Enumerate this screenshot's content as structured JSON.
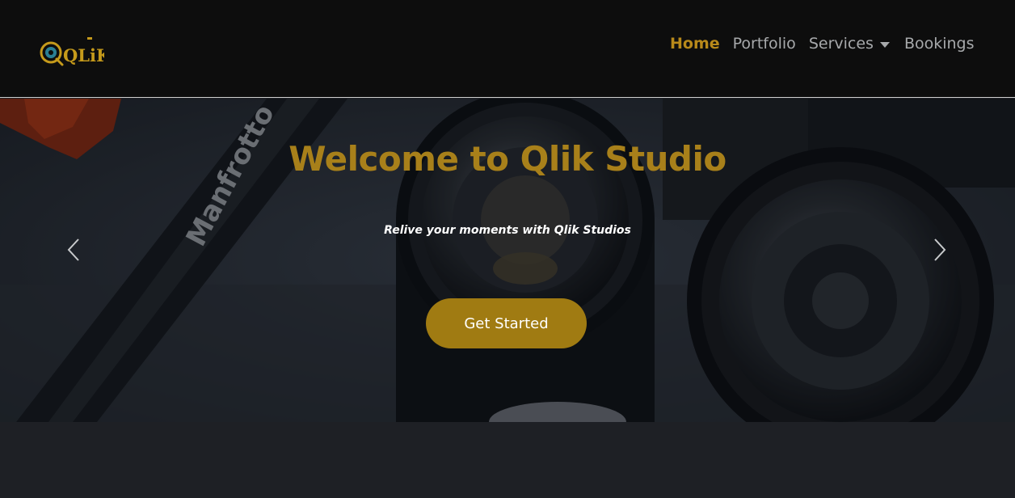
{
  "brand": {
    "logo_text": "QLiK"
  },
  "nav": {
    "home": "Home",
    "portfolio": "Portfolio",
    "services": "Services",
    "bookings": "Bookings"
  },
  "hero": {
    "title": "Welcome to Qlik Studio",
    "subtitle": "Relive your moments with Qlik Studios",
    "cta_label": "Get Started",
    "photo_subject": "camera lenses and Manfrotto tripod",
    "photo_text": "Manfrotto"
  },
  "carousel": {
    "prev_icon": "chevron-left-icon",
    "next_icon": "chevron-right-icon"
  },
  "colors": {
    "accent": "#b8891a",
    "header_bg": "#0d0d0d",
    "button_bg": "#a07b12",
    "page_bg": "#1e2025"
  }
}
